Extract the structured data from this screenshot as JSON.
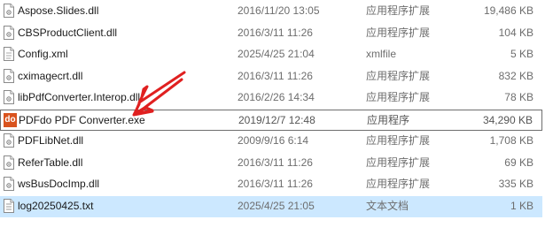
{
  "files": [
    {
      "name": "Aspose.Slides.dll",
      "date": "2016/11/20 13:05",
      "type": "应用程序扩展",
      "size": "19,486 KB",
      "icon": "dll-file-icon"
    },
    {
      "name": "CBSProductClient.dll",
      "date": "2016/3/11 11:26",
      "type": "应用程序扩展",
      "size": "104 KB",
      "icon": "dll-file-icon"
    },
    {
      "name": "Config.xml",
      "date": "2025/4/25 21:04",
      "type": "xmlfile",
      "size": "5 KB",
      "icon": "xml-file-icon"
    },
    {
      "name": "cximagecrt.dll",
      "date": "2016/3/11 11:26",
      "type": "应用程序扩展",
      "size": "832 KB",
      "icon": "dll-file-icon"
    },
    {
      "name": "libPdfConverter.Interop.dll",
      "date": "2016/2/26 14:34",
      "type": "应用程序扩展",
      "size": "78 KB",
      "icon": "dll-file-icon"
    },
    {
      "name": "PDFdo PDF Converter.exe",
      "date": "2019/12/7 12:48",
      "type": "应用程序",
      "size": "34,290 KB",
      "icon": "pdfdo-app-icon",
      "icon_text": "do"
    },
    {
      "name": "PDFLibNet.dll",
      "date": "2009/9/16 6:14",
      "type": "应用程序扩展",
      "size": "1,708 KB",
      "icon": "dll-file-icon"
    },
    {
      "name": "ReferTable.dll",
      "date": "2016/3/11 11:26",
      "type": "应用程序扩展",
      "size": "69 KB",
      "icon": "dll-file-icon"
    },
    {
      "name": "wsBusDocImp.dll",
      "date": "2016/3/11 11:26",
      "type": "应用程序扩展",
      "size": "335 KB",
      "icon": "dll-file-icon"
    },
    {
      "name": "log20250425.txt",
      "date": "2025/4/25 21:05",
      "type": "文本文档",
      "size": "1 KB",
      "icon": "text-file-icon"
    }
  ],
  "selected_index": 5,
  "highlight_index": 9,
  "colors": {
    "arrow": "#e02020",
    "selection_border": "#6e6e6e",
    "highlight_bg": "#cce8ff"
  }
}
